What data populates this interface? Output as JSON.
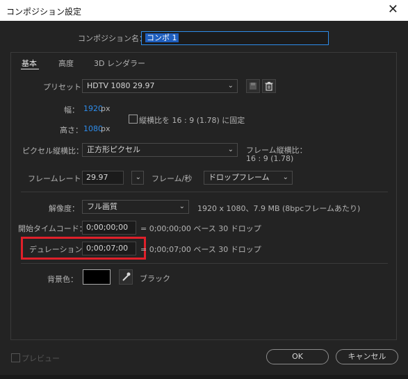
{
  "window": {
    "title": "コンポジション設定",
    "close_glyph": "✕"
  },
  "comp_name": {
    "label": "コンポジション名：",
    "value": "コンポ 1"
  },
  "tabs": [
    {
      "label": "基本",
      "active": true
    },
    {
      "label": "高度",
      "active": false
    },
    {
      "label": "3D レンダラー",
      "active": false
    }
  ],
  "preset": {
    "label": "プリセット：",
    "value": "HDTV 1080 29.97"
  },
  "width": {
    "label": "幅：",
    "value": "1920",
    "unit": "px"
  },
  "height": {
    "label": "高さ：",
    "value": "1080",
    "unit": "px"
  },
  "aspect_lock": {
    "label": "縦横比を 16 : 9 (1.78) に固定",
    "checked": false
  },
  "pixel_aspect": {
    "label": "ピクセル縦横比：",
    "value": "正方形ピクセル"
  },
  "frame_aspect": {
    "label": "フレーム縦横比：",
    "value": "16 : 9 (1.78)"
  },
  "frame_rate": {
    "label": "フレームレート：",
    "value": "29.97",
    "unit": "フレーム/秒",
    "mode": "ドロップフレーム"
  },
  "resolution": {
    "label": "解像度：",
    "value": "フル画質",
    "info": "1920 x 1080、7.9 MB (8bpcフレームあたり)"
  },
  "start_timecode": {
    "label": "開始タイムコード：",
    "value": "0;00;00;00",
    "info": "= 0;00;00;00 ベース 30 ドロップ"
  },
  "duration": {
    "label": "デュレーション：",
    "value": "0;00;07;00",
    "info": "= 0;00;07;00 ベース 30 ドロップ",
    "highlight_color": "#e0202a"
  },
  "background": {
    "label": "背景色：",
    "color_name": "ブラック",
    "swatch": "#000000"
  },
  "footer": {
    "preview_label": "プレビュー",
    "ok_label": "OK",
    "cancel_label": "キャンセル"
  },
  "colors": {
    "accent": "#2d8ceb",
    "panel_bg": "#232323",
    "highlight": "#e0202a"
  },
  "icons": [
    "close-icon",
    "chevron-down-icon",
    "save-preset-icon",
    "trash-icon",
    "eyedropper-icon",
    "checkbox-icon"
  ]
}
